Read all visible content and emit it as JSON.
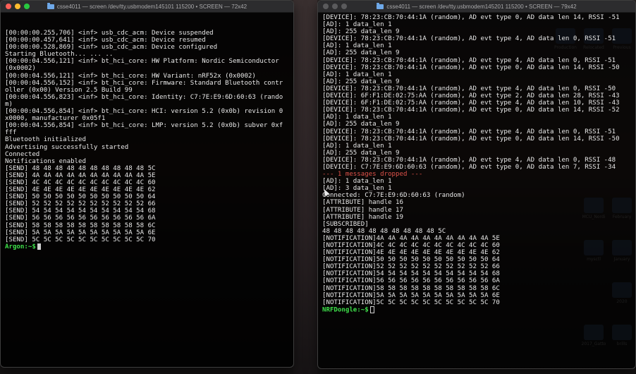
{
  "desktop": {
    "icons": [
      {
        "label": "Production",
        "color": "#4a6fa0"
      },
      {
        "label": "Relocated",
        "color": "#4a6fa0"
      },
      {
        "label": "Previous",
        "color": "#4a6fa0"
      },
      {
        "label": "MCU_Nordi",
        "color": "#4a6fa0"
      },
      {
        "label": "February",
        "color": "#4a6fa0"
      },
      {
        "label": "mysctl",
        "color": "#4a6fa0"
      },
      {
        "label": "January",
        "color": "#4a6fa0"
      },
      {
        "label": "2020",
        "color": "#4a6fa0"
      },
      {
        "label": "2017_Gatto",
        "color": "#4a6fa0"
      },
      {
        "label": "brills",
        "color": "#4a6fa0"
      }
    ]
  },
  "left_window": {
    "title": "csse4011 — screen /dev/tty.usbmodem145101 115200 • SCREEN — 72x42",
    "lines": [
      "[00:00:00.255,706] <inf> usb_cdc_acm: Device suspended",
      "[00:00:00.457,641] <inf> usb_cdc_acm: Device resumed",
      "[00:00:00.528,869] <inf> usb_cdc_acm: Device configured",
      "Starting Bluetooth... ... ..",
      "[00:00:04.556,121] <inf> bt_hci_core: HW Platform: Nordic Semiconductor",
      "(0x0002)",
      "[00:00:04.556,121] <inf> bt_hci_core: HW Variant: nRF52x (0x0002)",
      "[00:00:04.556,152] <inf> bt_hci_core: Firmware: Standard Bluetooth contr",
      "oller (0x00) Version 2.5 Build 99",
      "[00:00:04.556,823] <inf> bt_hci_core: Identity: C7:7E:E9:6D:60:63 (rando",
      "m)",
      "[00:00:04.556,854] <inf> bt_hci_core: HCI: version 5.2 (0x0b) revision 0",
      "x0000, manufacturer 0x05f1",
      "[00:00:04.556,854] <inf> bt_hci_core: LMP: version 5.2 (0x0b) subver 0xf",
      "fff",
      "Bluetooth initialized",
      "Advertising successfully started",
      "Connected",
      "Notifications enabled",
      "[SEND] 48 48 48 48 48 48 48 48 48 48 5C",
      "[SEND] 4A 4A 4A 4A 4A 4A 4A 4A 4A 4A 5E",
      "[SEND] 4C 4C 4C 4C 4C 4C 4C 4C 4C 4C 60",
      "[SEND] 4E 4E 4E 4E 4E 4E 4E 4E 4E 4E 62",
      "[SEND] 50 50 50 50 50 50 50 50 50 50 64",
      "[SEND] 52 52 52 52 52 52 52 52 52 52 66",
      "[SEND] 54 54 54 54 54 54 54 54 54 54 68",
      "[SEND] 56 56 56 56 56 56 56 56 56 56 6A",
      "[SEND] 58 58 58 58 58 58 58 58 58 58 6C",
      "[SEND] 5A 5A 5A 5A 5A 5A 5A 5A 5A 5A 6E",
      "[SEND] 5C 5C 5C 5C 5C 5C 5C 5C 5C 5C 70"
    ],
    "prompt": "Argon:~$"
  },
  "right_window": {
    "title": "csse4011 — screen /dev/tty.usbmodem145201 115200 • SCREEN — 79x42",
    "lines": [
      {
        "text": "[DEVICE]: 78:23:CB:70:44:1A (random), AD evt type 0, AD data len 14, RSSI -51",
        "style": "normal"
      },
      {
        "text": "[AD]: 1 data_len 1",
        "style": "normal"
      },
      {
        "text": "[AD]: 255 data_len 9",
        "style": "normal"
      },
      {
        "text": "[DEVICE]: 78:23:CB:70:44:1A (random), AD evt type 4, AD data len 0, RSSI -51",
        "style": "normal"
      },
      {
        "text": "[AD]: 1 data_len 1",
        "style": "normal"
      },
      {
        "text": "[AD]: 255 data_len 9",
        "style": "normal"
      },
      {
        "text": "[DEVICE]: 78:23:CB:70:44:1A (random), AD evt type 4, AD data len 0, RSSI -51",
        "style": "normal"
      },
      {
        "text": "[DEVICE]: 78:23:CB:70:44:1A (random), AD evt type 0, AD data len 14, RSSI -50",
        "style": "normal"
      },
      {
        "text": "[AD]: 1 data_len 1",
        "style": "normal"
      },
      {
        "text": "[AD]: 255 data_len 9",
        "style": "normal"
      },
      {
        "text": "[DEVICE]: 78:23:CB:70:44:1A (random), AD evt type 4, AD data len 0, RSSI -50",
        "style": "normal"
      },
      {
        "text": "[DEVICE]: 6F:F1:DE:02:75:AA (random), AD evt type 2, AD data len 28, RSSI -43",
        "style": "normal"
      },
      {
        "text": "[DEVICE]: 6F:F1:DE:02:75:AA (random), AD evt type 4, AD data len 10, RSSI -43",
        "style": "normal"
      },
      {
        "text": "[DEVICE]: 78:23:CB:70:44:1A (random), AD evt type 0, AD data len 14, RSSI -52",
        "style": "normal"
      },
      {
        "text": "[AD]: 1 data_len 1",
        "style": "normal"
      },
      {
        "text": "[AD]: 255 data_len 9",
        "style": "normal"
      },
      {
        "text": "[DEVICE]: 78:23:CB:70:44:1A (random), AD evt type 4, AD data len 0, RSSI -51",
        "style": "normal"
      },
      {
        "text": "[DEVICE]: 78:23:CB:70:44:1A (random), AD evt type 0, AD data len 14, RSSI -50",
        "style": "normal"
      },
      {
        "text": "[AD]: 1 data_len 1",
        "style": "normal"
      },
      {
        "text": "[AD]: 255 data_len 9",
        "style": "normal"
      },
      {
        "text": "[DEVICE]: 78:23:CB:70:44:1A (random), AD evt type 4, AD data len 0, RSSI -48",
        "style": "normal"
      },
      {
        "text": "[DEVICE]: C7:7E:E9:6D:60:63 (random), AD evt type 0, AD data len 7, RSSI -34",
        "style": "normal"
      },
      {
        "text": "--- 1 messages dropped ---",
        "style": "red"
      },
      {
        "text": "[AD]: 1 data_len 1",
        "style": "normal"
      },
      {
        "text": "[AD]: 3 data_len 1",
        "style": "normal"
      },
      {
        "text": "Connected: C7:7E:E9:6D:60:63 (random)",
        "style": "normal"
      },
      {
        "text": "[ATTRIBUTE] handle 16",
        "style": "normal"
      },
      {
        "text": "[ATTRIBUTE] handle 17",
        "style": "normal"
      },
      {
        "text": "[ATTRIBUTE] handle 19",
        "style": "normal"
      },
      {
        "text": "[SUBSCRIBED]",
        "style": "normal"
      },
      {
        "text": "48 48 48 48 48 48 48 48 48 48 5C",
        "style": "normal"
      },
      {
        "text": "[NOTIFICATION]4A 4A 4A 4A 4A 4A 4A 4A 4A 4A 5E",
        "style": "normal"
      },
      {
        "text": "[NOTIFICATION]4C 4C 4C 4C 4C 4C 4C 4C 4C 4C 60",
        "style": "normal"
      },
      {
        "text": "[NOTIFICATION]4E 4E 4E 4E 4E 4E 4E 4E 4E 4E 62",
        "style": "normal"
      },
      {
        "text": "[NOTIFICATION]50 50 50 50 50 50 50 50 50 50 64",
        "style": "normal"
      },
      {
        "text": "[NOTIFICATION]52 52 52 52 52 52 52 52 52 52 66",
        "style": "normal"
      },
      {
        "text": "[NOTIFICATION]54 54 54 54 54 54 54 54 54 54 68",
        "style": "normal"
      },
      {
        "text": "[NOTIFICATION]56 56 56 56 56 56 56 56 56 56 6A",
        "style": "normal"
      },
      {
        "text": "[NOTIFICATION]58 58 58 58 58 58 58 58 58 58 6C",
        "style": "normal"
      },
      {
        "text": "[NOTIFICATION]5A 5A 5A 5A 5A 5A 5A 5A 5A 5A 6E",
        "style": "normal"
      },
      {
        "text": "[NOTIFICATION]5C 5C 5C 5C 5C 5C 5C 5C 5C 5C 70",
        "style": "normal"
      }
    ],
    "prompt": "NRFDongle:~$"
  },
  "colors": {
    "prompt_green": "#3ee04a",
    "dropped_red": "#e0524a",
    "traffic_red": "#ff5f57",
    "traffic_yellow": "#febc2e",
    "traffic_green": "#28c840"
  }
}
